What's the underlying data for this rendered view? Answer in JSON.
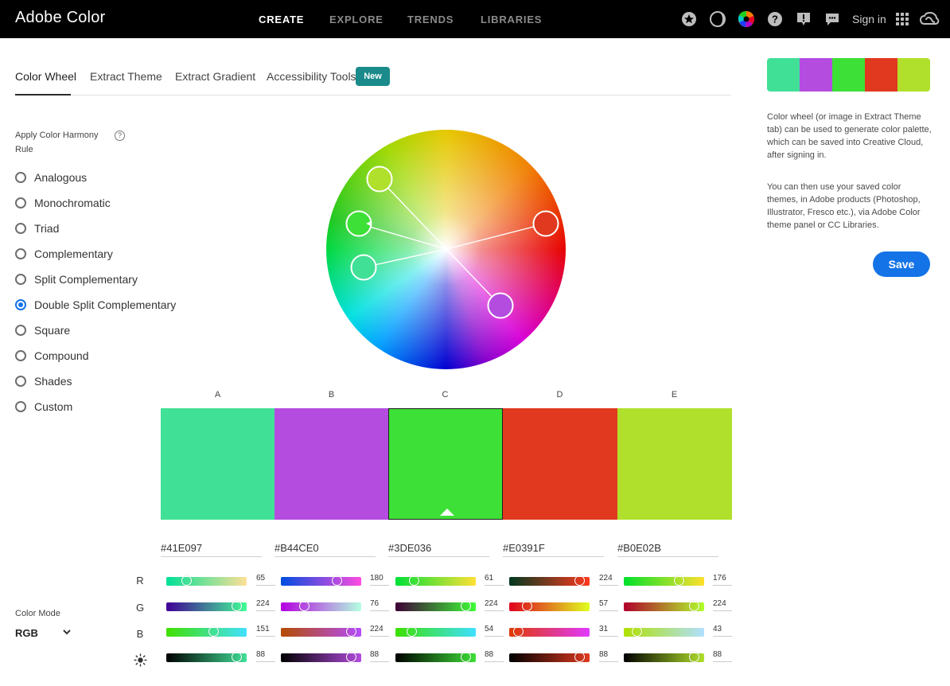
{
  "topbar": {
    "brand": "Adobe Color",
    "nav": [
      {
        "label": "CREATE",
        "active": true
      },
      {
        "label": "EXPLORE",
        "active": false
      },
      {
        "label": "TRENDS",
        "active": false
      },
      {
        "label": "LIBRARIES",
        "active": false
      }
    ],
    "icons": [
      "favorites-icon",
      "contrast-icon",
      "color-wheel-icon",
      "help-icon",
      "feedback-icon",
      "chat-icon",
      "apps-grid-icon",
      "creative-cloud-icon"
    ],
    "signin": "Sign in"
  },
  "tabs": [
    {
      "label": "Color Wheel",
      "active": true
    },
    {
      "label": "Extract Theme",
      "active": false
    },
    {
      "label": "Extract Gradient",
      "active": false
    },
    {
      "label": "Accessibility Tools",
      "active": false
    }
  ],
  "new_badge": "New",
  "harmony": {
    "title": "Apply Color Harmony Rule",
    "help": "?",
    "rules": [
      {
        "label": "Analogous",
        "checked": false
      },
      {
        "label": "Monochromatic",
        "checked": false
      },
      {
        "label": "Triad",
        "checked": false
      },
      {
        "label": "Complementary",
        "checked": false
      },
      {
        "label": "Split Complementary",
        "checked": false
      },
      {
        "label": "Double Split Complementary",
        "checked": true
      },
      {
        "label": "Square",
        "checked": false
      },
      {
        "label": "Compound",
        "checked": false
      },
      {
        "label": "Shades",
        "checked": false
      },
      {
        "label": "Custom",
        "checked": false
      }
    ]
  },
  "swatches": [
    {
      "letter": "A",
      "hex": "#41E097",
      "color": "#41E097",
      "selected": false,
      "rgb": [
        65,
        224,
        151
      ],
      "brightness": 88
    },
    {
      "letter": "B",
      "hex": "#B44CE0",
      "color": "#B44CE0",
      "selected": false,
      "rgb": [
        180,
        76,
        224
      ],
      "brightness": 88
    },
    {
      "letter": "C",
      "hex": "#3DE036",
      "color": "#3DE036",
      "selected": true,
      "rgb": [
        61,
        224,
        54
      ],
      "brightness": 88
    },
    {
      "letter": "D",
      "hex": "#E0391F",
      "color": "#E0391F",
      "selected": false,
      "rgb": [
        224,
        57,
        31
      ],
      "brightness": 88
    },
    {
      "letter": "E",
      "hex": "#B0E02B",
      "color": "#B0E02B",
      "selected": false,
      "rgb": [
        176,
        224,
        43
      ],
      "brightness": 88
    }
  ],
  "channel_labels": [
    "R",
    "G",
    "B",
    "brightness-icon"
  ],
  "color_mode": {
    "label": "Color Mode",
    "value": "RGB"
  },
  "info": {
    "p1": "Color wheel (or image in Extract Theme tab) can be used to generate color palette, which can be saved into Creative Cloud, after signing in.",
    "p2": "You can then use your saved color themes, in Adobe products (Photoshop, Illustrator, Fresco etc.), via Adobe Color theme panel or CC Libraries."
  },
  "save_label": "Save"
}
